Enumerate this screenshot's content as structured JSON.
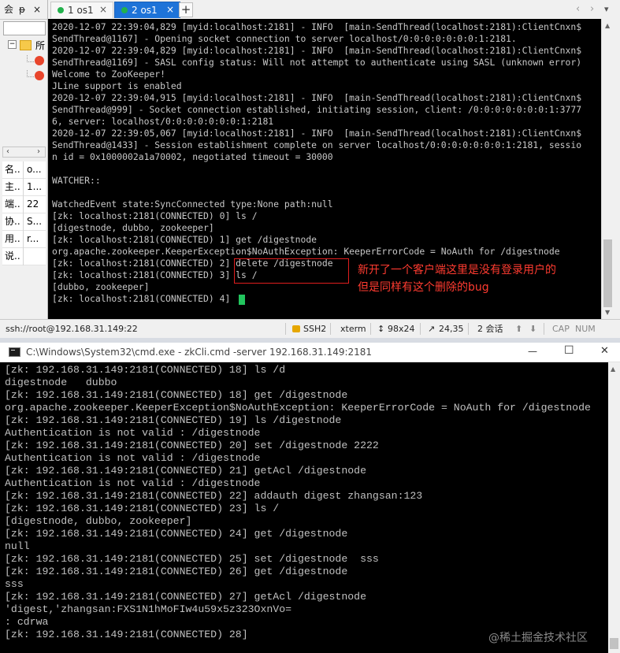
{
  "left_panel": {
    "header": [
      "会",
      "ᵽ",
      "×"
    ],
    "tree_root_label": "所",
    "arrows": [
      "‹",
      "›"
    ],
    "properties": [
      {
        "k": "名..",
        "v": "o..."
      },
      {
        "k": "主..",
        "v": "1..."
      },
      {
        "k": "端..",
        "v": "22"
      },
      {
        "k": "协..",
        "v": "S..."
      },
      {
        "k": "用..",
        "v": "r..."
      },
      {
        "k": "说..",
        "v": ""
      }
    ]
  },
  "tabs": [
    {
      "label": "1 os1",
      "active": false
    },
    {
      "label": "2 os1",
      "active": true
    }
  ],
  "tab_controls": {
    "add": "+",
    "prev": "‹",
    "next": "›",
    "menu": "▾"
  },
  "terminal_top": {
    "lines": [
      "2020-12-07 22:39:04,829 [myid:localhost:2181] - INFO  [main-SendThread(localhost:2181):ClientCnxn$",
      "SendThread@1167] - Opening socket connection to server localhost/0:0:0:0:0:0:0:1:2181.",
      "2020-12-07 22:39:04,829 [myid:localhost:2181] - INFO  [main-SendThread(localhost:2181):ClientCnxn$",
      "SendThread@1169] - SASL config status: Will not attempt to authenticate using SASL (unknown error)",
      "Welcome to ZooKeeper!",
      "JLine support is enabled",
      "2020-12-07 22:39:04,915 [myid:localhost:2181] - INFO  [main-SendThread(localhost:2181):ClientCnxn$",
      "SendThread@999] - Socket connection established, initiating session, client: /0:0:0:0:0:0:0:1:3777",
      "6, server: localhost/0:0:0:0:0:0:0:1:2181",
      "2020-12-07 22:39:05,067 [myid:localhost:2181] - INFO  [main-SendThread(localhost:2181):ClientCnxn$",
      "SendThread@1433] - Session establishment complete on server localhost/0:0:0:0:0:0:0:1:2181, sessio",
      "n id = 0x1000002a1a70002, negotiated timeout = 30000",
      "",
      "WATCHER::",
      "",
      "WatchedEvent state:SyncConnected type:None path:null",
      "[zk: localhost:2181(CONNECTED) 0] ls /",
      "[digestnode, dubbo, zookeeper]",
      "[zk: localhost:2181(CONNECTED) 1] get /digestnode",
      "org.apache.zookeeper.KeeperException$NoAuthException: KeeperErrorCode = NoAuth for /digestnode",
      "[zk: localhost:2181(CONNECTED) 2] delete /digestnode",
      "[zk: localhost:2181(CONNECTED) 3] ls /",
      "[dubbo, zookeeper]",
      "[zk: localhost:2181(CONNECTED) 4] "
    ]
  },
  "annotation": {
    "line1": "新开了一个客户端这里是没有登录用户的",
    "line2": "但是同样有这个删除的bug"
  },
  "status_bar": {
    "connection": "ssh://root@192.168.31.149:22",
    "protocol": "SSH2",
    "terminal_type": "xterm",
    "size": "98x24",
    "cursor": "24,35",
    "sessions": "2 会话",
    "caps": "CAP",
    "num": "NUM"
  },
  "cmd_window": {
    "title": "C:\\Windows\\System32\\cmd.exe - zkCli.cmd  -server 192.168.31.149:2181",
    "minimize": "—",
    "maximize": "☐",
    "close": "✕",
    "lines": [
      "[zk: 192.168.31.149:2181(CONNECTED) 18] ls /d",
      "digestnode   dubbo",
      "[zk: 192.168.31.149:2181(CONNECTED) 18] get /digestnode",
      "org.apache.zookeeper.KeeperException$NoAuthException: KeeperErrorCode = NoAuth for /digestnode",
      "[zk: 192.168.31.149:2181(CONNECTED) 19] ls /digestnode",
      "Authentication is not valid : /digestnode",
      "[zk: 192.168.31.149:2181(CONNECTED) 20] set /digestnode 2222",
      "Authentication is not valid : /digestnode",
      "[zk: 192.168.31.149:2181(CONNECTED) 21] getAcl /digestnode",
      "Authentication is not valid : /digestnode",
      "[zk: 192.168.31.149:2181(CONNECTED) 22] addauth digest zhangsan:123",
      "[zk: 192.168.31.149:2181(CONNECTED) 23] ls /",
      "[digestnode, dubbo, zookeeper]",
      "[zk: 192.168.31.149:2181(CONNECTED) 24] get /digestnode",
      "null",
      "[zk: 192.168.31.149:2181(CONNECTED) 25] set /digestnode  sss",
      "[zk: 192.168.31.149:2181(CONNECTED) 26] get /digestnode",
      "sss",
      "[zk: 192.168.31.149:2181(CONNECTED) 27] getAcl /digestnode",
      "'digest,'zhangsan:FXS1N1hMoFIw4u59x5z323OxnVo=",
      ": cdrwa",
      "[zk: 192.168.31.149:2181(CONNECTED) 28]"
    ]
  },
  "watermark": "@稀土掘金技术社区",
  "colors": {
    "terminal_bg": "#000000",
    "terminal_text": "#c8c8c8",
    "cursor": "#22c55e",
    "annotation": "#ff3b30",
    "tab_active": "#1e73d8",
    "session_dot": "#22b14c"
  }
}
